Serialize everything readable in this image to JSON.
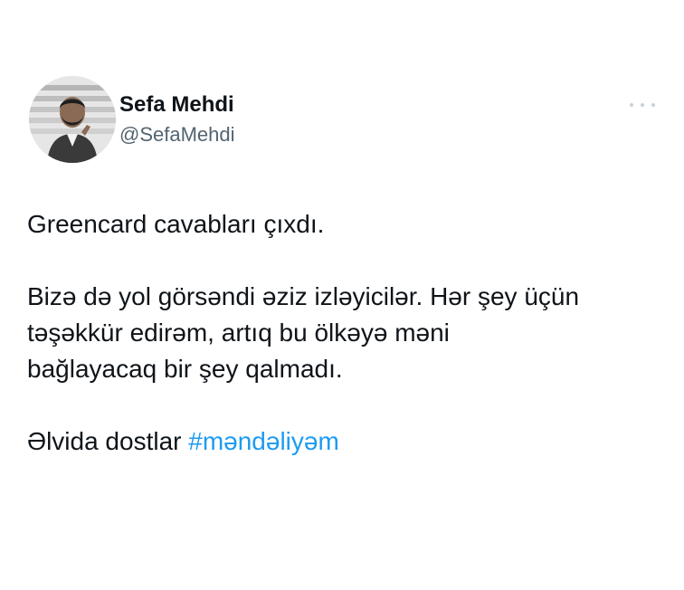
{
  "author": {
    "display_name": "Sefa Mehdi",
    "handle": "@SefaMehdi",
    "avatar_icon": "person-photo-icon"
  },
  "more_icon": "more-horizontal-icon",
  "tweet": {
    "paragraph_1": "Greencard cavabları çıxdı.",
    "paragraph_2_line_1": "Bizə də yol görsəndi əziz izləyicilər. Hər şey üçün",
    "paragraph_2_line_2": "təşəkkür edirəm, artıq bu ölkəyə məni",
    "paragraph_2_line_3": "bağlayacaq bir şey qalmadı.",
    "paragraph_3_text": "Əlvida dostlar",
    "hashtag": "#məndəliyəm"
  },
  "colors": {
    "text": "#0f1419",
    "secondary": "#536471",
    "link": "#1d9bf0"
  }
}
